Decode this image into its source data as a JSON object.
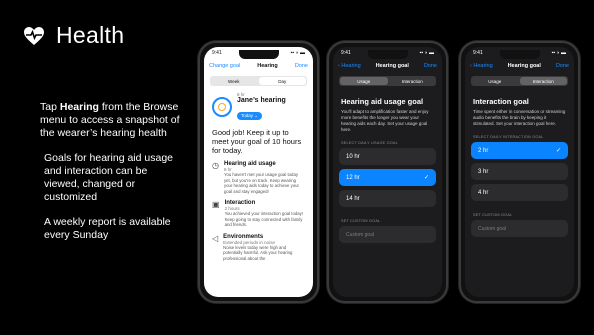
{
  "slide": {
    "title": "Health",
    "icon": "heart-pulse-icon",
    "notes": {
      "n1_pre": "Tap ",
      "n1_bold": "Hearing",
      "n1_post": " from the Browse menu to access a snapshot of the wearer’s hearing health",
      "n2": "Goals for hearing aid usage and interaction can be viewed, changed or customized",
      "n3": "A weekly report is available every Sunday"
    }
  },
  "phone1": {
    "time": "9:41",
    "nav_left": "Change goal",
    "nav_title": "Hearing",
    "nav_right": "Done",
    "seg": [
      "Week",
      "Day"
    ],
    "user_small": "8 hr",
    "user_name": "Jane’s hearing",
    "pill": "Today",
    "headline": "Good job! Keep it up to meet your goal of 10 hours for today.",
    "items": [
      {
        "icon": "clock-icon",
        "title": "Hearing aid usage",
        "sub": "8 hr",
        "body": "You haven't met your usage goal today yet, but you're on track. Keep wearing your hearing aids today to achieve your goal and stay engaged!"
      },
      {
        "icon": "chat-icon",
        "title": "Interaction",
        "sub": "2 hours",
        "body": "You achieved your interaction goal today! Keep going to stay connected with family and friends."
      },
      {
        "icon": "speaker-icon",
        "title": "Environments",
        "sub": "Extended periods in noise",
        "body": "Noise levels today were high and potentially harmful. Ask your hearing professional about the"
      }
    ]
  },
  "phone2": {
    "time": "9:41",
    "nav_left": "Hearing",
    "nav_title": "Hearing goal",
    "nav_right": "Done",
    "seg": [
      "Usage",
      "Interaction"
    ],
    "goal_title": "Hearing aid usage goal",
    "goal_desc": "You'll adapt to amplification faster and enjoy more benefits the longer you wear your hearing aids each day. Set your usage goal here.",
    "caption": "SELECT DAILY USAGE GOAL",
    "options": [
      "10 hr",
      "12 hr",
      "14 hr"
    ],
    "custom_caption": "SET CUSTOM GOAL",
    "custom_placeholder": "Custom goal"
  },
  "phone3": {
    "time": "9:41",
    "nav_left": "Hearing",
    "nav_title": "Hearing goal",
    "nav_right": "Done",
    "seg": [
      "Usage",
      "Interaction"
    ],
    "goal_title": "Interaction goal",
    "goal_desc": "Time spent either in conversation or streaming audio benefits the brain by keeping it stimulated. Set your interaction goal here.",
    "caption": "SELECT DAILY INTERACTION GOAL",
    "options": [
      "2 hr",
      "3 hr",
      "4 hr"
    ],
    "custom_caption": "SET CUSTOM GOAL",
    "custom_placeholder": "Custom goal"
  },
  "colors": {
    "accent": "#1a8cff",
    "background": "#000000",
    "dark_screen": "#1c1c1e"
  }
}
